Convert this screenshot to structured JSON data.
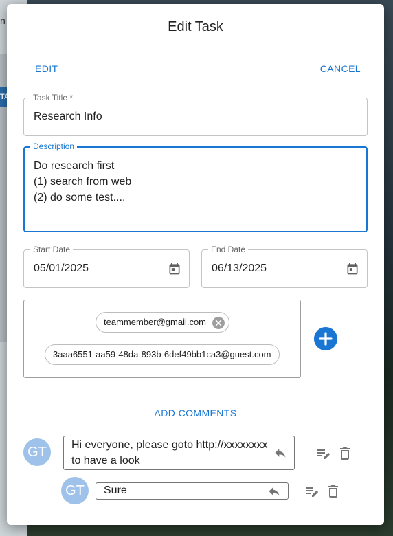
{
  "background": {
    "top_text": "n",
    "tab_text": "TA"
  },
  "dialog": {
    "title": "Edit Task",
    "edit_label": "EDIT",
    "cancel_label": "CANCEL",
    "task_title": {
      "label": "Task Title *",
      "value": "Research Info"
    },
    "description": {
      "label": "Description",
      "lines": [
        "Do research first",
        "(1) search from web",
        "(2) do some test...."
      ]
    },
    "start_date": {
      "label": "Start Date",
      "value": "05/01/2025"
    },
    "end_date": {
      "label": "End Date",
      "value": "06/13/2025"
    },
    "members": [
      "teammember@gmail.com",
      "3aaa6551-aa59-48da-893b-6def49bb1ca3@guest.com"
    ],
    "add_comments_label": "ADD COMMENTS",
    "comments": [
      {
        "avatar": "GT",
        "text_lines": [
          "Hi everyone, please goto http://xxxxxxxx",
          "to have a look"
        ]
      },
      {
        "avatar": "GT",
        "text_lines": [
          "Sure"
        ]
      }
    ]
  },
  "colors": {
    "accent": "#1976d2",
    "avatar": "#9fc2ea",
    "border": "#c4c4c4"
  },
  "icons": [
    "calendar-icon",
    "close-circle-icon",
    "add-circle-icon",
    "reply-icon",
    "edit-note-icon",
    "delete-icon"
  ]
}
